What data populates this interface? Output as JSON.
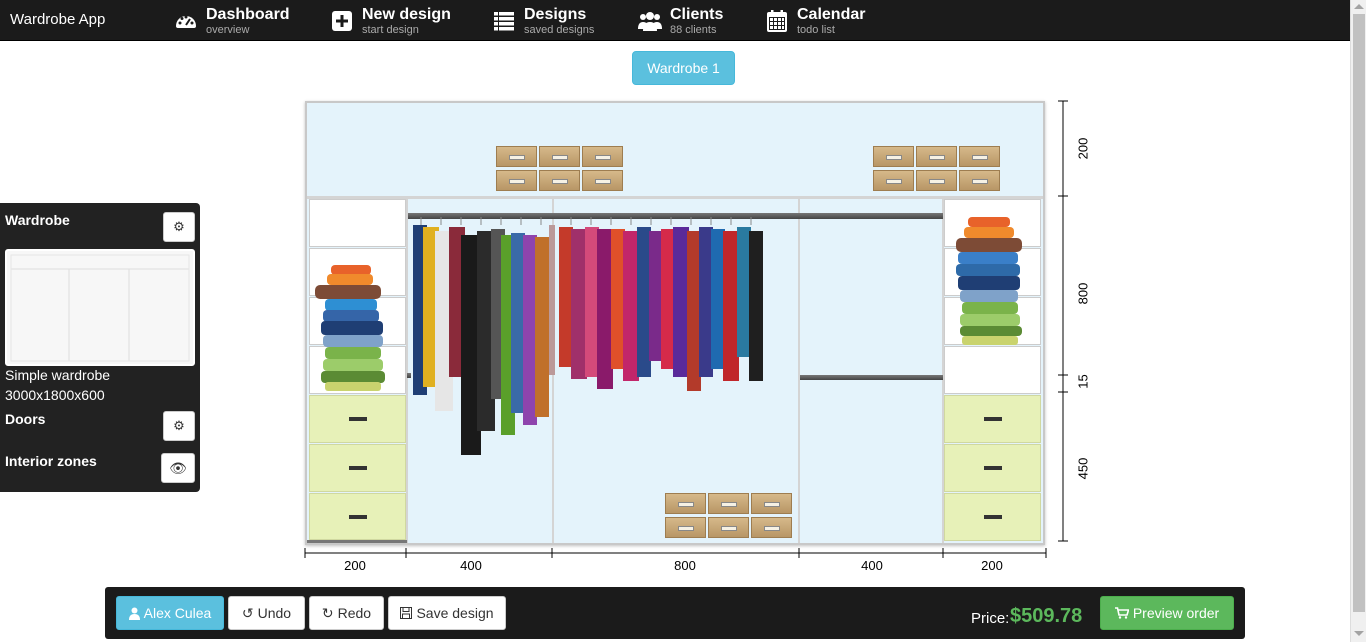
{
  "app": {
    "title": "Wardrobe App"
  },
  "nav": [
    {
      "label": "Dashboard",
      "sub": "overview",
      "icon": "dashboard-icon"
    },
    {
      "label": "New design",
      "sub": "start design",
      "icon": "plus-square-icon"
    },
    {
      "label": "Designs",
      "sub": "saved designs",
      "icon": "list-icon"
    },
    {
      "label": "Clients",
      "sub": "88 clients",
      "icon": "users-icon"
    },
    {
      "label": "Calendar",
      "sub": "todo list",
      "icon": "calendar-icon"
    }
  ],
  "tabs": {
    "active": "Wardrobe 1"
  },
  "side_panel": {
    "wardrobe_heading": "Wardrobe",
    "wardrobe_name": "Simple wardrobe",
    "wardrobe_size": "3000x1800x600",
    "doors_heading": "Doors",
    "interior_heading": "Interior zones",
    "settings_icon": "gear-icon",
    "visibility_icon": "eye-icon"
  },
  "dimensions": {
    "widths": [
      "200",
      "400",
      "800",
      "400",
      "200"
    ],
    "heights": [
      "200",
      "800",
      "15",
      "450"
    ]
  },
  "footer": {
    "user_label": "Alex Culea",
    "undo_label": "Undo",
    "redo_label": "Redo",
    "save_label": "Save design",
    "price_label": "Price:",
    "price_value": "$509.78",
    "preview_label": "Preview order"
  },
  "colors": {
    "nav_bg": "#1b1b1b",
    "info": "#5bc0de",
    "success": "#5cb85c",
    "wardrobe_bg": "#e4f3fb",
    "drawer": "#e7f1b8"
  }
}
